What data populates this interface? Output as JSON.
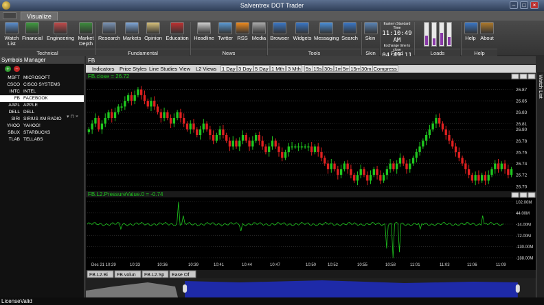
{
  "window": {
    "title": "Salventrex DOT Trader",
    "controls": [
      "min",
      "max",
      "close"
    ]
  },
  "ribbon_tab": "Visualize",
  "ribbon": {
    "buttons": [
      {
        "label": "Watch List",
        "icon": "watchlist-icon",
        "color": "#5a8fd0"
      },
      {
        "label": "Financial",
        "icon": "financial-chart-icon",
        "color": "#3f9c3f"
      },
      {
        "label": "Engineering",
        "icon": "engineering-icon",
        "color": "#c24a4a"
      },
      {
        "label": "Market Depth",
        "icon": "market-depth-icon",
        "color": "#3c8d3c"
      },
      {
        "label": "Research",
        "icon": "books-icon",
        "color": "#7a93b5"
      },
      {
        "label": "Markets",
        "icon": "markets-icon",
        "color": "#7fa7d9"
      },
      {
        "label": "Opinion",
        "icon": "opinion-icon",
        "color": "#d7c07a"
      },
      {
        "label": "Education",
        "icon": "apple-icon",
        "color": "#c03030"
      },
      {
        "label": "Headline",
        "icon": "newspaper-icon",
        "color": "#cfcfcf"
      },
      {
        "label": "Twitter",
        "icon": "bird-icon",
        "color": "#5b9bd5"
      },
      {
        "label": "RSS",
        "icon": "rss-icon",
        "color": "#f08a1c"
      },
      {
        "label": "Media",
        "icon": "media-icon",
        "color": "#aaaaaa"
      },
      {
        "label": "Browser",
        "icon": "globe-icon",
        "color": "#3a78c8"
      },
      {
        "label": "Widgets",
        "icon": "widgets-icon",
        "color": "#3a78c8"
      },
      {
        "label": "Messaging",
        "icon": "messaging-icon",
        "color": "#4a8fd8"
      },
      {
        "label": "Search",
        "icon": "search-icon",
        "color": "#3a78c8"
      },
      {
        "label": "Skin",
        "icon": "skin-icon",
        "color": "#5b86b8"
      },
      {
        "label": "Help",
        "icon": "help-icon",
        "color": "#3a78c8"
      },
      {
        "label": "About",
        "icon": "about-icon",
        "color": "#b07a2a"
      }
    ],
    "groups": [
      "Technical",
      "Fundamental",
      "News",
      "Tools",
      "Skin",
      "Feed",
      "Loads",
      "Help"
    ],
    "feed": {
      "tz_label": "Eastern Standard Time",
      "time": "11:10:49 AM",
      "close_label": "Exchange time to close",
      "countdown": "04:49:11"
    }
  },
  "symbols_manager": {
    "title": "Symbols Manager",
    "symbols": [
      {
        "ticker": "MSFT",
        "name": "MICROSOFT"
      },
      {
        "ticker": "CSCO",
        "name": "CISCO SYSTEMS"
      },
      {
        "ticker": "INTC",
        "name": "INTEL"
      },
      {
        "ticker": "FB",
        "name": "FACEBOOK",
        "selected": true
      },
      {
        "ticker": "AAPL",
        "name": "APPLE"
      },
      {
        "ticker": "DELL",
        "name": "DELL"
      },
      {
        "ticker": "SIRI",
        "name": "SIRIUS XM RADIO"
      },
      {
        "ticker": "YHOO",
        "name": "YAHOO!"
      },
      {
        "ticker": "SBUX",
        "name": "STARBUCKS"
      },
      {
        "ticker": "TLAB",
        "name": "TELLABS"
      }
    ]
  },
  "chart_window": {
    "title": "FB",
    "menu": [
      "Indicators",
      "Price Styles",
      "Line Studies",
      "View",
      "L2 Views"
    ],
    "timeframes": [
      "1 Day",
      "3 Day",
      "5 Day",
      "1 Mth",
      "3 Mth",
      "5s",
      "15s",
      "30s",
      "1m",
      "5m",
      "15m",
      "30m"
    ],
    "compress_label": "Compress",
    "watch_list_tab": "Watch List",
    "bottom_tabs": [
      "FB.L2.Bi",
      "FB.volun",
      "FB.L2.Sp",
      "Ease Of"
    ]
  },
  "status": "LicenseValid",
  "chart_data": [
    {
      "type": "candlestick",
      "title": "FB.close = 26.72",
      "y_ticks": [
        26.87,
        26.85,
        26.83,
        26.81,
        26.8,
        26.78,
        26.76,
        26.74,
        26.72,
        26.7
      ],
      "ylim": [
        26.695,
        26.885
      ],
      "grid": true,
      "up_color": "#1fc81f",
      "down_color": "#e02020",
      "closes": [
        26.8,
        26.81,
        26.82,
        26.8,
        26.81,
        26.82,
        26.83,
        26.82,
        26.83,
        26.84,
        26.84,
        26.85,
        26.86,
        26.85,
        26.86,
        26.87,
        26.86,
        26.85,
        26.84,
        26.85,
        26.84,
        26.83,
        26.82,
        26.83,
        26.82,
        26.81,
        26.82,
        26.83,
        26.82,
        26.81,
        26.8,
        26.81,
        26.8,
        26.79,
        26.8,
        26.81,
        26.8,
        26.79,
        26.78,
        26.79,
        26.8,
        26.79,
        26.78,
        26.77,
        26.78,
        26.77,
        26.78,
        26.79,
        26.78,
        26.77,
        26.78,
        26.79,
        26.78,
        26.77,
        26.76,
        26.77,
        26.78,
        26.77,
        26.76,
        26.75,
        26.76,
        26.77,
        26.77,
        26.77,
        26.77,
        26.77,
        26.77,
        26.77,
        26.76,
        26.77,
        26.76,
        26.75,
        26.74,
        26.73,
        26.74,
        26.73,
        26.72,
        26.73,
        26.74,
        26.73,
        26.72,
        26.71,
        26.72,
        26.73,
        26.72,
        26.71,
        26.72,
        26.73,
        26.72,
        26.71,
        26.72,
        26.73,
        26.74,
        26.73,
        26.74,
        26.75,
        26.74,
        26.73,
        26.74,
        26.75,
        26.76,
        26.77,
        26.78,
        26.79,
        26.8,
        26.81,
        26.82,
        26.81,
        26.8,
        26.79,
        26.78,
        26.77,
        26.76,
        26.75,
        26.74,
        26.73,
        26.72,
        26.71,
        26.72,
        26.71,
        26.72,
        26.71,
        26.72,
        26.73,
        26.74,
        26.73,
        26.74,
        26.73,
        26.72,
        26.73
      ],
      "time_labels": [
        "Dec 21 10:29",
        "10:33",
        "10:36",
        "10:39",
        "10:41",
        "10:44",
        "10:47",
        "10:50",
        "10:52",
        "10:55",
        "10:58",
        "11:01",
        "11:03",
        "11:06",
        "11:09"
      ]
    },
    {
      "type": "line",
      "title": "FB.L2.PressureValue.0 = -0.74",
      "y_ticks": [
        "102.00M",
        "44.00M",
        "-14.00M",
        "-72.00M",
        "-130.00M",
        "-188.00M"
      ],
      "y_tick_values": [
        102,
        44,
        -14,
        -72,
        -130,
        -188
      ],
      "ylim": [
        -195,
        110
      ],
      "grid": true,
      "color": "#1fc81f",
      "spikes": [
        {
          "t": 0.08,
          "v": -40
        },
        {
          "t": 0.22,
          "v": 100
        },
        {
          "t": 0.23,
          "v": 30
        },
        {
          "t": 0.37,
          "v": -50
        },
        {
          "t": 0.72,
          "v": -140
        },
        {
          "t": 0.735,
          "v": -190
        },
        {
          "t": 0.75,
          "v": -160
        },
        {
          "t": 0.8,
          "v": -40
        },
        {
          "t": 0.95,
          "v": 30
        }
      ],
      "baseline": -14
    },
    {
      "type": "area",
      "title": "navigator",
      "fill_left": "#777777",
      "fill_selected": "#1e2aa8",
      "selection": [
        0.22,
        0.96
      ]
    }
  ]
}
